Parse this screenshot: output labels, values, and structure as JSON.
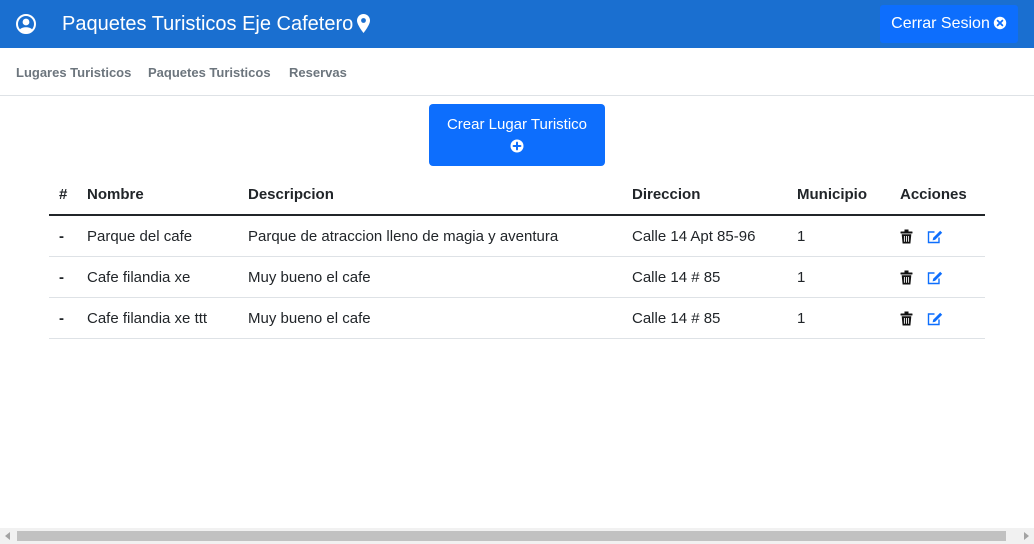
{
  "header": {
    "title": "Paquetes Turisticos Eje Cafetero",
    "logout_label": "Cerrar Sesion",
    "user_icon": "user-circle-icon",
    "pin_icon": "map-pin-icon"
  },
  "nav": {
    "items": [
      {
        "label": "Lugares Turisticos"
      },
      {
        "label": "Paquetes Turisticos"
      },
      {
        "label": "Reservas"
      }
    ]
  },
  "create_button": {
    "label": "Crear Lugar Turistico",
    "icon": "plus-circle-icon"
  },
  "table": {
    "headers": {
      "num": "#",
      "nombre": "Nombre",
      "descripcion": "Descripcion",
      "direccion": "Direccion",
      "municipio": "Municipio",
      "acciones": "Acciones"
    },
    "rows": [
      {
        "num": "-",
        "nombre": "Parque del cafe",
        "descripcion": "Parque de atraccion lleno de magia y aventura",
        "direccion": "Calle 14 Apt 85-96",
        "municipio": "1"
      },
      {
        "num": "-",
        "nombre": "Cafe filandia xe",
        "descripcion": "Muy bueno el cafe",
        "direccion": "Calle 14 # 85",
        "municipio": "1"
      },
      {
        "num": "-",
        "nombre": "Cafe filandia xe ttt",
        "descripcion": "Muy bueno el cafe",
        "direccion": "Calle 14 # 85",
        "municipio": "1"
      }
    ],
    "action_icons": [
      "trash-icon",
      "edit-icon"
    ]
  },
  "colors": {
    "header_bg": "#1a6fd0",
    "primary": "#0d6efd",
    "nav_text": "#6c757d",
    "edit_icon": "#0d6efd"
  }
}
